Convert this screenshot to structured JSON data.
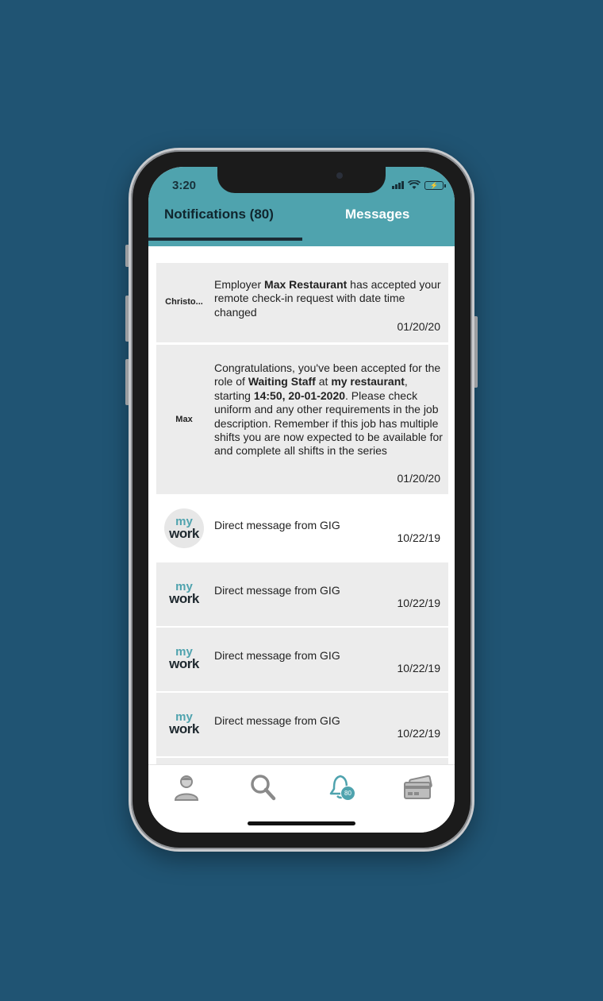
{
  "status_bar": {
    "time": "3:20"
  },
  "tabs": {
    "notifications": "Notifications (80)",
    "messages": "Messages"
  },
  "notifications": [
    {
      "sender": "Christo...",
      "parts": [
        {
          "text": "Employer ",
          "bold": false
        },
        {
          "text": "Max Restaurant",
          "bold": true
        },
        {
          "text": " has accepted your remote check-in request with date time changed",
          "bold": false
        }
      ],
      "date": "01/20/20"
    },
    {
      "sender": "Max",
      "parts": [
        {
          "text": "Congratulations, you've been accepted for the role of ",
          "bold": false
        },
        {
          "text": "Waiting Staff",
          "bold": true
        },
        {
          "text": " at ",
          "bold": false
        },
        {
          "text": "my restaurant",
          "bold": true
        },
        {
          "text": ", starting ",
          "bold": false
        },
        {
          "text": "14:50, 20-01-2020",
          "bold": true
        },
        {
          "text": ". Please check uniform and any other requirements in the job description. Remember if this job has multiple shifts you are now expected to be available for and complete all shifts in the series",
          "bold": false
        }
      ],
      "date": "01/20/20"
    },
    {
      "logo_top": "my",
      "logo_bottom": "work",
      "text": "Direct message from GIG",
      "date": "10/22/19"
    },
    {
      "logo_top": "my",
      "logo_bottom": "work",
      "text": "Direct message from GIG",
      "date": "10/22/19"
    },
    {
      "logo_top": "my",
      "logo_bottom": "work",
      "text": "Direct message from GIG",
      "date": "10/22/19"
    },
    {
      "logo_top": "my",
      "logo_bottom": "work",
      "text": "Direct message from GIG",
      "date": "10/22/19"
    }
  ],
  "bottom_nav": {
    "items": [
      {
        "icon": "profile-icon"
      },
      {
        "icon": "search-icon"
      },
      {
        "icon": "bell-icon",
        "badge": "80"
      },
      {
        "icon": "wallet-card-icon"
      }
    ]
  },
  "colors": {
    "background": "#205473",
    "accent": "#4fa3ae",
    "card": "#ececec"
  }
}
